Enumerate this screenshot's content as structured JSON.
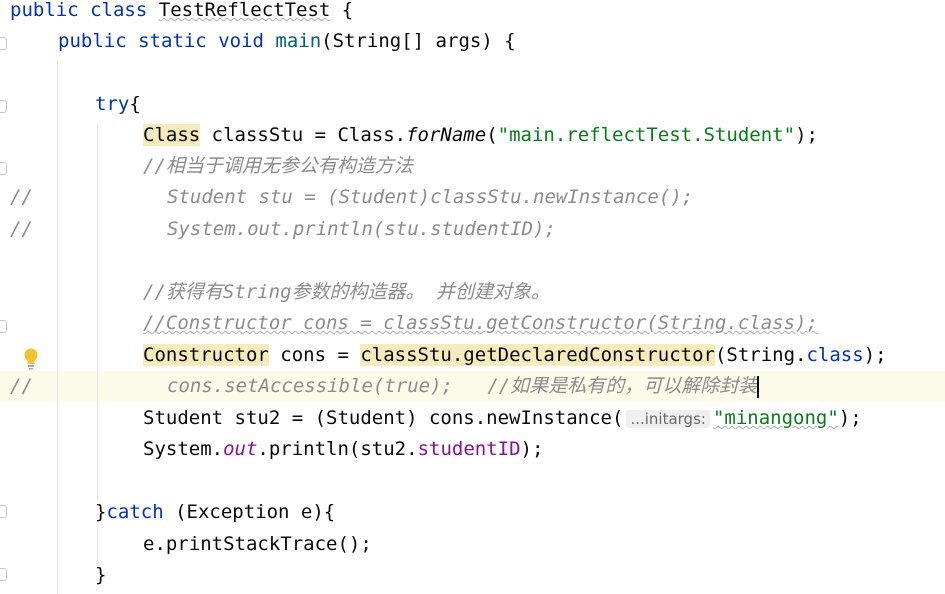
{
  "editor": {
    "line1": {
      "kw1": "public",
      "kw2": "class",
      "name": "TestReflectTest",
      "brace": " {"
    },
    "line2": {
      "kw1": "public",
      "kw2": "static",
      "kw3": "void",
      "name": "main",
      "params": "(String[] args) {"
    },
    "line4": {
      "kw": "try",
      "brace": "{"
    },
    "line5": {
      "type": "Class",
      "rest1": " classStu = Class.",
      "method": "forName",
      "open": "(",
      "str": "\"main.reflectTest.Student\"",
      "close": ");"
    },
    "line6": {
      "comment": "//相当于调用无参公有构造方法"
    },
    "line7": {
      "slash": "//",
      "code": "Student stu = (Student)classStu.newInstance();"
    },
    "line8": {
      "slash": "//",
      "code": "System.out.println(stu.studentID);"
    },
    "line10": {
      "comment": "//获得有String参数的构造器。 并创建对象。"
    },
    "line11": {
      "comment": "//Constructor cons = classStu.getConstructor(String.class);"
    },
    "line12": {
      "type": "Constructor",
      "rest1": " cons = ",
      "call": "classStu.getDeclaredConstructor",
      "rest2": "(String.",
      "kw": "class",
      "rest3": ");"
    },
    "line13": {
      "slash": "//",
      "code": "cons.setAccessible(true);",
      "comment": "//如果是私有的，可以解除封装"
    },
    "line14": {
      "rest1": "Student stu2 = (Student) cons.newInstance(",
      "hint": "...initargs:",
      "str": "\"minangong\"",
      "rest2": ");"
    },
    "line15": {
      "rest1": "System.",
      "field": "out",
      "rest2": ".println(stu2.",
      "field2": "studentID",
      "rest3": ");"
    },
    "line17": {
      "brace": "}",
      "kw": "catch",
      "rest": " (Exception e){"
    },
    "line18": {
      "code": "e.printStackTrace();"
    },
    "line19": {
      "brace": "}"
    }
  }
}
